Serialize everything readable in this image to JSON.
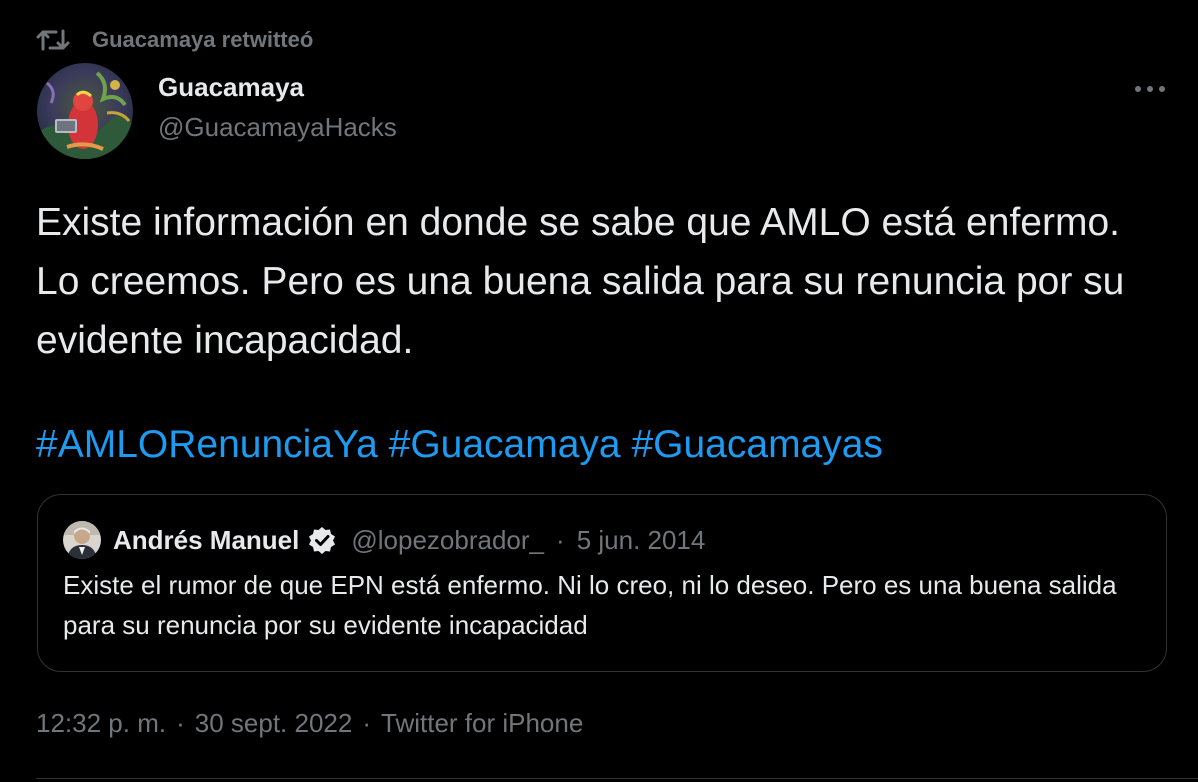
{
  "retweet": {
    "icon": "retweet-icon",
    "label": "Guacamaya retwitteó"
  },
  "tweet": {
    "author": {
      "name": "Guacamaya",
      "handle": "@GuacamayaHacks",
      "avatar": "avatar-illustration"
    },
    "text": "Existe información en donde se sabe que AMLO está enfermo. Lo creemos. Pero es una buena salida para su renuncia por su evidente incapacidad.",
    "hashtags": [
      "#AMLORenunciaYa",
      "#Guacamaya",
      "#Guacamayas"
    ],
    "more_icon": "more-horizontal-icon",
    "time": "12:32 p. m.",
    "separator": "·",
    "date": "30 sept. 2022",
    "source": "Twitter for iPhone"
  },
  "quote": {
    "name": "Andrés Manuel",
    "verified_icon": "verified-badge-icon",
    "handle": "@lopezobrador_",
    "separator": "·",
    "date": "5 jun. 2014",
    "text": "Existe el rumor de que EPN está enfermo. Ni lo creo, ni lo deseo. Pero es una buena salida para su renuncia por su evidente incapacidad"
  },
  "colors": {
    "background": "#000000",
    "text_primary": "#e7e9ea",
    "text_secondary": "#71767b",
    "link": "#1d9bf0",
    "border": "#2f3336"
  }
}
